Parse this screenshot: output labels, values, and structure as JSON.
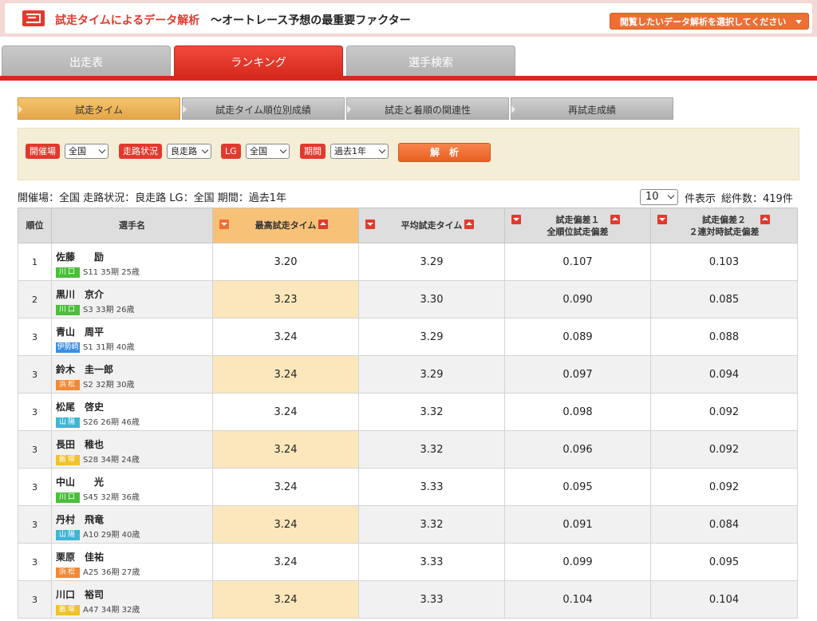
{
  "header": {
    "title": "試走タイムによるデータ解析",
    "subtitle": "〜オートレース予想の最重要ファクター",
    "select_label": "閲覧したいデータ解析を選択してください"
  },
  "tabs": [
    {
      "label": "出走表",
      "active": false
    },
    {
      "label": "ランキング",
      "active": true
    },
    {
      "label": "選手検索",
      "active": false
    }
  ],
  "subtabs": [
    {
      "label": "試走タイム",
      "active": true
    },
    {
      "label": "試走タイム順位別成績",
      "active": false
    },
    {
      "label": "試走と着順の関連性",
      "active": false
    },
    {
      "label": "再試走成績",
      "active": false
    }
  ],
  "filters": {
    "venue_label": "開催場",
    "venue_value": "全国",
    "track_label": "走路状況",
    "track_value": "良走路",
    "lg_label": "LG",
    "lg_value": "全国",
    "period_label": "期間",
    "period_value": "過去1年",
    "analyze_label": "解析"
  },
  "summary": {
    "text": "開催場：全国 走路状況：良走路 LG：全国 期間：過去1年",
    "per_page": "10",
    "per_page_label": "件表示",
    "total": "総件数：419件"
  },
  "table": {
    "headers": {
      "rank": "順位",
      "name": "選手名",
      "best": "最高試走タイム",
      "avg": "平均試走タイム",
      "dev1_line1": "試走偏差１",
      "dev1_line2": "全順位試走偏差",
      "dev2_line1": "試走偏差２",
      "dev2_line2": "２連対時試走偏差"
    },
    "rows": [
      {
        "rank": "1",
        "name": "佐藤　　励",
        "venue": "川口",
        "venue_class": "v-kawaguchi",
        "info": "S11  35期  25歳",
        "best": "3.20",
        "avg": "3.29",
        "dev1": "0.107",
        "dev2": "0.103"
      },
      {
        "rank": "2",
        "name": "黒川　京介",
        "venue": "川口",
        "venue_class": "v-kawaguchi",
        "info": "S3  33期  26歳",
        "best": "3.23",
        "avg": "3.30",
        "dev1": "0.090",
        "dev2": "0.085"
      },
      {
        "rank": "3",
        "name": "青山　周平",
        "venue": "伊勢崎",
        "venue_class": "v-isesaki",
        "info": "S1  31期  40歳",
        "best": "3.24",
        "avg": "3.29",
        "dev1": "0.089",
        "dev2": "0.088"
      },
      {
        "rank": "3",
        "name": "鈴木　圭一郎",
        "venue": "浜松",
        "venue_class": "v-hamamatsu",
        "info": "S2  32期  30歳",
        "best": "3.24",
        "avg": "3.29",
        "dev1": "0.097",
        "dev2": "0.094"
      },
      {
        "rank": "3",
        "name": "松尾　啓史",
        "venue": "山陽",
        "venue_class": "v-sanyo",
        "info": "S26  26期  46歳",
        "best": "3.24",
        "avg": "3.32",
        "dev1": "0.098",
        "dev2": "0.092"
      },
      {
        "rank": "3",
        "name": "長田　稚也",
        "venue": "飯塚",
        "venue_class": "v-iizuka",
        "info": "S28  34期  24歳",
        "best": "3.24",
        "avg": "3.32",
        "dev1": "0.096",
        "dev2": "0.092"
      },
      {
        "rank": "3",
        "name": "中山　　光",
        "venue": "川口",
        "venue_class": "v-kawaguchi",
        "info": "S45  32期  36歳",
        "best": "3.24",
        "avg": "3.33",
        "dev1": "0.095",
        "dev2": "0.092"
      },
      {
        "rank": "3",
        "name": "丹村　飛竜",
        "venue": "山陽",
        "venue_class": "v-sanyo",
        "info": "A10  29期  40歳",
        "best": "3.24",
        "avg": "3.32",
        "dev1": "0.091",
        "dev2": "0.084"
      },
      {
        "rank": "3",
        "name": "栗原　佳祐",
        "venue": "浜松",
        "venue_class": "v-hamamatsu",
        "info": "A25  36期  27歳",
        "best": "3.24",
        "avg": "3.33",
        "dev1": "0.099",
        "dev2": "0.095"
      },
      {
        "rank": "3",
        "name": "川口　裕司",
        "venue": "飯塚",
        "venue_class": "v-iizuka",
        "info": "A47  34期  32歳",
        "best": "3.24",
        "avg": "3.33",
        "dev1": "0.104",
        "dev2": "0.104"
      }
    ]
  }
}
